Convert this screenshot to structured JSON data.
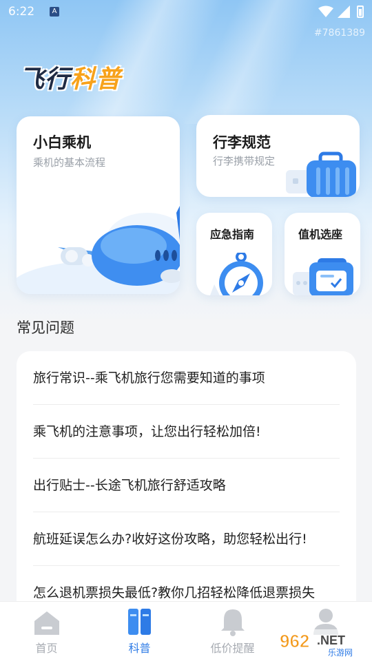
{
  "status_bar": {
    "time": "6:22",
    "notification_icon": "A"
  },
  "watermark_id": "#7861389",
  "logo": {
    "part1": "飞行",
    "part2": "科普"
  },
  "cards": {
    "boarding": {
      "title": "小白乘机",
      "subtitle": "乘机的基本流程"
    },
    "luggage": {
      "title": "行李规范",
      "subtitle": "行李携带规定"
    },
    "emergency": {
      "title": "应急指南"
    },
    "checkin": {
      "title": "值机选座"
    }
  },
  "faq": {
    "title": "常见问题",
    "items": [
      "旅行常识--乘飞机旅行您需要知道的事项",
      "乘飞机的注意事项，让您出行轻松加倍!",
      "出行贴士--长途飞机旅行舒适攻略",
      "航班延误怎么办?收好这份攻略，助您轻松出行!",
      "怎么退机票损失最低?教你几招轻松降低退票损失"
    ]
  },
  "tabs": [
    {
      "label": "首页",
      "icon": "home-icon",
      "active": false
    },
    {
      "label": "科普",
      "icon": "books-icon",
      "active": true
    },
    {
      "label": "低价提醒",
      "icon": "bell-icon",
      "active": false
    },
    {
      "label": "",
      "icon": "user-icon",
      "active": false
    }
  ],
  "badge": {
    "main": "962",
    "suffix": ".NET",
    "sub": "乐游网"
  },
  "colors": {
    "accent": "#2e7be6",
    "logo_orange": "#f7a21b",
    "tab_inactive": "#a7abb2"
  }
}
